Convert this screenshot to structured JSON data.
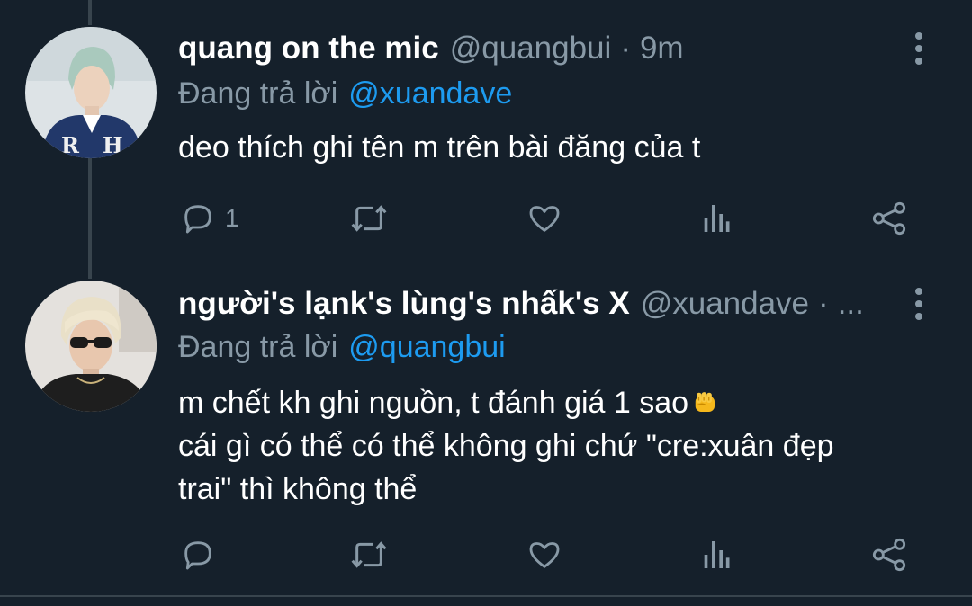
{
  "colors": {
    "background": "#15202b",
    "text_primary": "#ffffff",
    "text_secondary": "#8899a6",
    "link": "#1d9bf0",
    "divider": "#38444d"
  },
  "tweets": [
    {
      "display_name": "quang on the mic",
      "handle": "@quangbui",
      "separator": "·",
      "time": "9m",
      "reply_label": "Đang trả lời",
      "reply_mention": "@xuandave",
      "text_lines": [
        "deo thích ghi tên m trên bài đăng của t"
      ],
      "reply_count": "1",
      "icons": [
        "reply-icon",
        "retweet-icon",
        "like-icon",
        "analytics-icon",
        "share-icon",
        "more-vertical-icon"
      ]
    },
    {
      "display_name": "người's lạnk's lùng's nhấk's X",
      "handle": "@xuandave",
      "separator": "·",
      "time": "...",
      "reply_label": "Đang trả lời",
      "reply_mention": "@quangbui",
      "text_lines": [
        "m chết kh ghi nguồn, t đánh giá 1 sao",
        "cái gì có thể có thể không ghi chứ \"cre:xuân đẹp",
        "trai\" thì không thể"
      ],
      "emoji": "oncoming-fist-emoji",
      "reply_count": "",
      "icons": [
        "reply-icon",
        "retweet-icon",
        "like-icon",
        "analytics-icon",
        "share-icon",
        "more-vertical-icon"
      ]
    }
  ]
}
